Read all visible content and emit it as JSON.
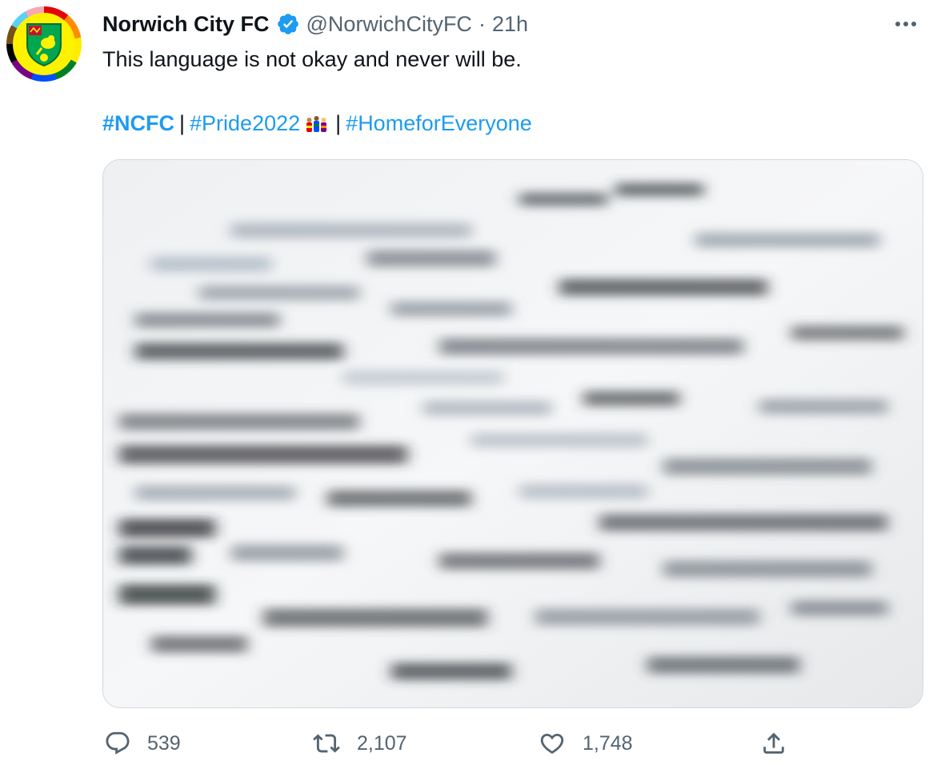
{
  "account": {
    "name": "Norwich City FC",
    "handle": "@NorwichCityFC",
    "separator": "·",
    "time": "21h",
    "verified": true
  },
  "tweet": {
    "text": "This language is not okay and never will be.",
    "hashtags": [
      "#NCFC",
      "#Pride2022",
      "#HomeforEveryone"
    ],
    "hashtag_separator": "|"
  },
  "actions": {
    "replies": "539",
    "retweets": "2,107",
    "likes": "1,748"
  },
  "icons": {
    "more": "more-horizontal-icon",
    "reply": "reply-icon",
    "retweet": "retweet-icon",
    "like": "heart-icon",
    "share": "share-icon",
    "verified": "verified-badge-icon"
  },
  "colors": {
    "link": "#1d9bf0",
    "verified": "#1d9bf0",
    "secondary_text": "#536471",
    "crest_yellow": "#fff200",
    "crest_green": "#00a650"
  }
}
